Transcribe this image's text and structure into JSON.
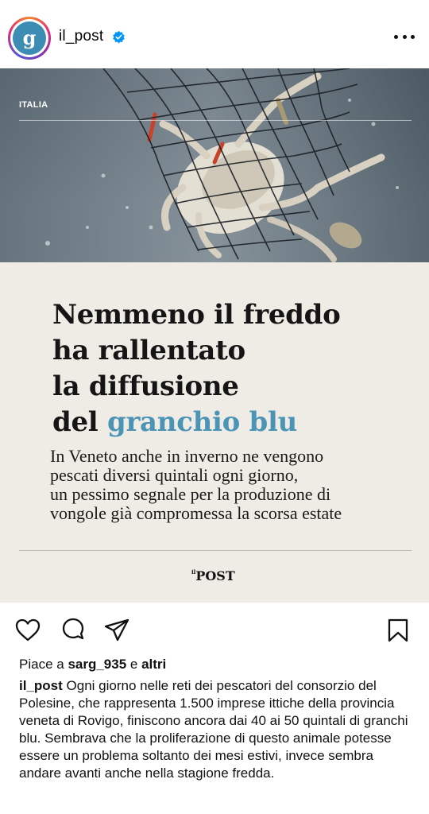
{
  "post": {
    "username": "il_post",
    "verified": true,
    "more_icon": "more-horizontal-icon"
  },
  "card": {
    "section": "ITALIA",
    "headline_lines": [
      "Nemmeno il freddo",
      "ha rallentato",
      "la diffusione"
    ],
    "headline_last_prefix": "del ",
    "headline_accent": "granchio blu",
    "subhead_lines": [
      "In Veneto anche in inverno ne vengono",
      "pescati diversi quintali ogni giorno,",
      "un pessimo segnale per la produzione di",
      "vongole già compromessa la scorsa estate"
    ],
    "logo_prefix": "il",
    "logo_text": "POST",
    "accent_color": "#4b94b6"
  },
  "actions": {
    "like_icon": "heart-icon",
    "comment_icon": "comment-icon",
    "share_icon": "send-icon",
    "save_icon": "bookmark-icon"
  },
  "likes": {
    "prefix": "Piace a ",
    "user": "sarg_935",
    "middle": " e ",
    "others": "altri"
  },
  "caption": {
    "user": "il_post",
    "text": " Ogni giorno nelle reti dei pescatori del consorzio del Polesine, che rappresenta 1.500 imprese ittiche della provincia veneta di Rovigo, finiscono ancora dai 40 ai 50 quintali di granchi blu. Sembrava che la proliferazione di questo animale potesse essere un problema soltanto dei mesi estivi, invece sembra andare avanti anche nella stagione fredda."
  }
}
